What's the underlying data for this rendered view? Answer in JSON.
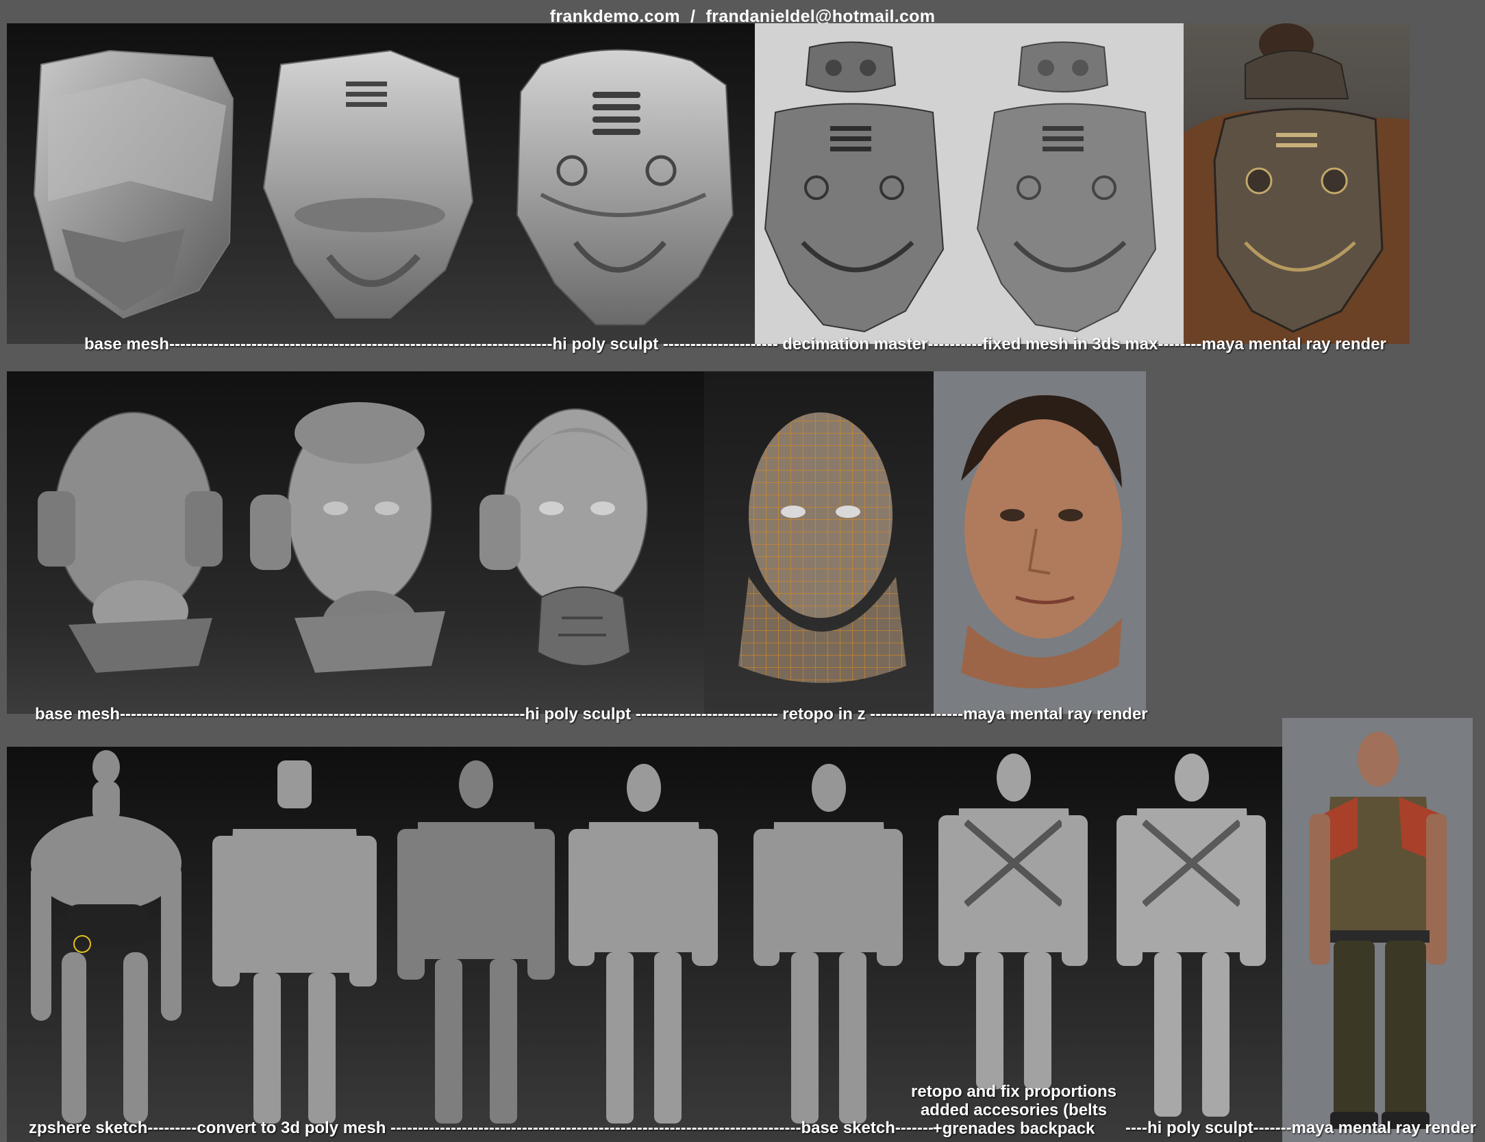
{
  "header": {
    "site": "frankdemo.com",
    "separator": "/",
    "email": "frandanieldel@hotmail.com"
  },
  "row1": {
    "caption": "base mesh----------------------------------------------------------------------hi poly sculpt --------------------- decimation master----------fixed mesh in 3ds max--------maya mental ray render",
    "stages": [
      "base mesh",
      "hi poly sculpt",
      "decimation master",
      "fixed mesh in 3ds max",
      "maya mental ray render"
    ]
  },
  "row2": {
    "caption": "base mesh--------------------------------------------------------------------------hi poly sculpt -------------------------- retopo in z -----------------maya mental ray render",
    "stages": [
      "base mesh",
      "hi poly sculpt",
      "retopo in z",
      "maya mental ray render"
    ]
  },
  "row3": {
    "caption_a": "zpshere sketch---------convert to 3d poly mesh ---------------------------------------------------------------------------base sketch--------",
    "caption_b_line1": "retopo and fix proportions",
    "caption_b_line2": "added accesories (belts",
    "caption_b_line3": "+grenades backpack",
    "caption_c": "----hi poly sculpt-------maya mental ray render"
  },
  "colors": {
    "dark_panel": "#1a1a1a",
    "grey_panel": "#d2d2d2",
    "render_bg": "#7a7d82",
    "sculpt_grey": "#8a8a8a",
    "wire_orange": "#d98a1e"
  }
}
